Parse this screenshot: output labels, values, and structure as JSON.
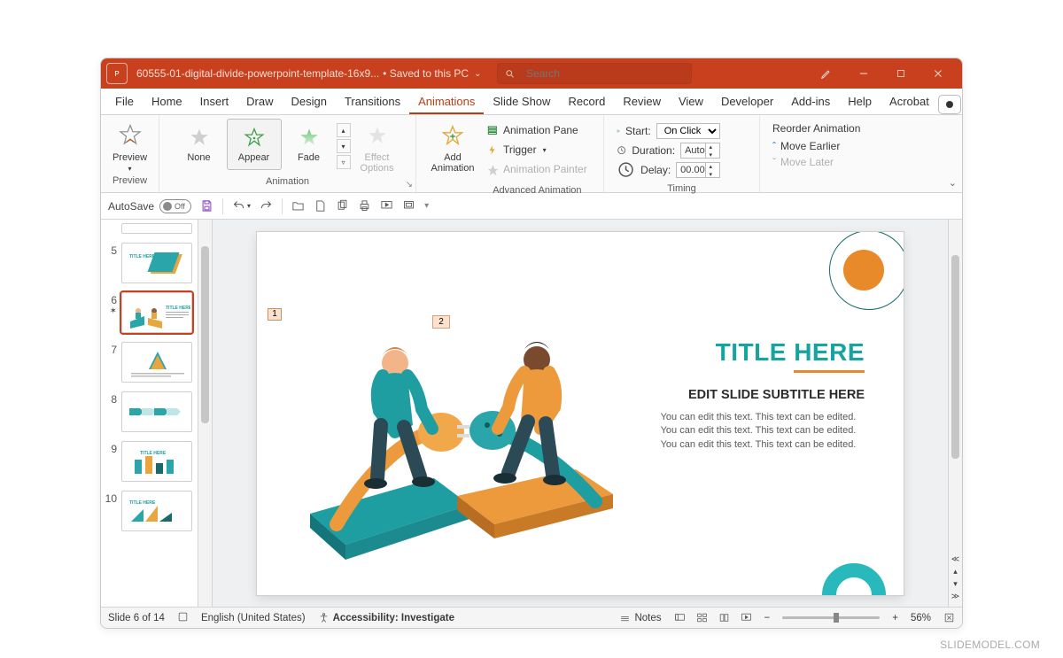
{
  "titlebar": {
    "document_name": "60555-01-digital-divide-powerpoint-template-16x9...",
    "saved_text": "• Saved to this PC",
    "search_placeholder": "Search"
  },
  "tabs": {
    "file": "File",
    "home": "Home",
    "insert": "Insert",
    "draw": "Draw",
    "design": "Design",
    "transitions": "Transitions",
    "animations": "Animations",
    "slideshow": "Slide Show",
    "record": "Record",
    "review": "Review",
    "view": "View",
    "developer": "Developer",
    "addins": "Add-ins",
    "help": "Help",
    "acrobat": "Acrobat"
  },
  "ribbon": {
    "preview": "Preview",
    "preview_group": "Preview",
    "none": "None",
    "appear": "Appear",
    "fade": "Fade",
    "effect_options": "Effect\nOptions",
    "animation_group": "Animation",
    "add_animation": "Add\nAnimation",
    "animation_pane": "Animation Pane",
    "trigger": "Trigger",
    "animation_painter": "Animation Painter",
    "advanced_group": "Advanced Animation",
    "start_label": "Start:",
    "start_value": "On Click",
    "duration_label": "Duration:",
    "duration_value": "Auto",
    "delay_label": "Delay:",
    "delay_value": "00.00",
    "timing_group": "Timing",
    "reorder": "Reorder Animation",
    "move_earlier": "Move Earlier",
    "move_later": "Move Later"
  },
  "qat": {
    "autosave": "AutoSave",
    "off": "Off"
  },
  "thumbnails": {
    "n5": "5",
    "n6": "6",
    "n7": "7",
    "n8": "8",
    "n9": "9",
    "n10": "10"
  },
  "slide": {
    "tag1": "1",
    "tag2": "2",
    "title": "TITLE HERE",
    "subtitle": "EDIT SLIDE SUBTITLE HERE",
    "body": "You can edit this text. This text can be edited. You can edit this text. This text can be edited. You can edit this text. This text can be edited."
  },
  "status": {
    "slide": "Slide 6 of 14",
    "lang": "English (United States)",
    "accessibility": "Accessibility: Investigate",
    "notes": "Notes",
    "zoom": "56%"
  },
  "watermark": "SLIDEMODEL.COM"
}
